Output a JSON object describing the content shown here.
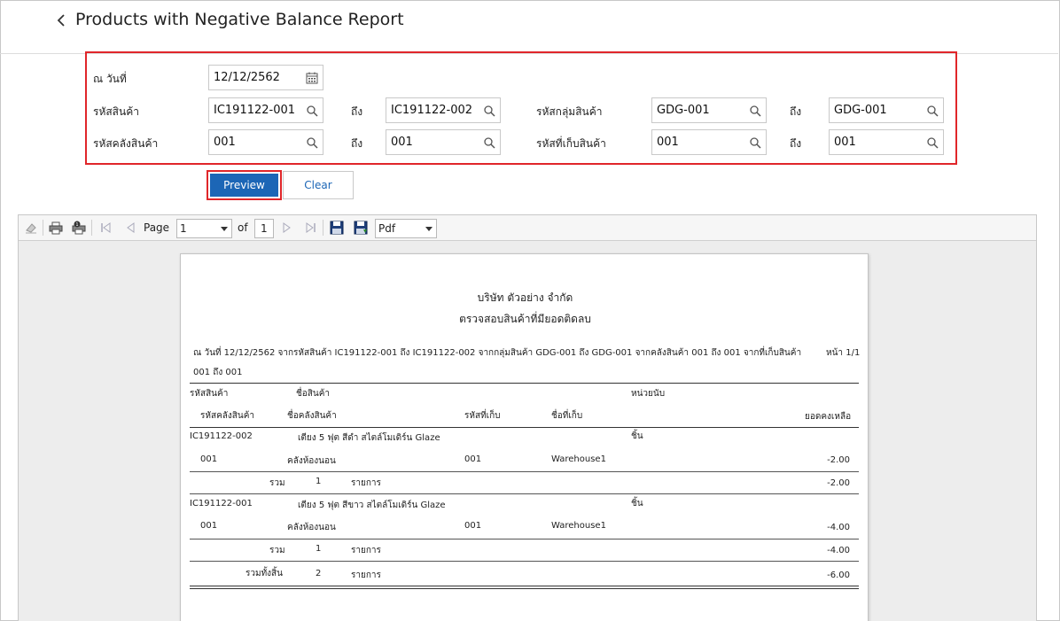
{
  "header": {
    "title": "Products with Negative Balance Report"
  },
  "filters": {
    "date_label": "ณ วันที่",
    "date_value": "12/12/2562",
    "product_code_label": "รหัสสินค้า",
    "product_from": "IC191122-001",
    "to_label": "ถึง",
    "product_to": "IC191122-002",
    "product_group_label": "รหัสกลุ่มสินค้า",
    "group_from": "GDG-001",
    "group_to": "GDG-001",
    "warehouse_label": "รหัสคลังสินค้า",
    "warehouse_from": "001",
    "warehouse_to": "001",
    "location_label": "รหัสที่เก็บสินค้า",
    "location_from": "001",
    "location_to": "001"
  },
  "buttons": {
    "preview": "Preview",
    "clear": "Clear"
  },
  "toolbar": {
    "page_label": "Page",
    "page_value": "1",
    "of_label": "of",
    "total_pages": "1",
    "format_value": "Pdf"
  },
  "report": {
    "company": "บริษัท ตัวอย่าง จำกัด",
    "title": "ตรวจสอบสินค้าที่มียอดติดลบ",
    "criteria_line1": "ณ วันที่ 12/12/2562 จากรหัสสินค้า IC191122-001 ถึง IC191122-002 จากกลุ่มสินค้า GDG-001 ถึง  GDG-001 จากคลังสินค้า 001 ถึง 001 จากที่เก็บสินค้า",
    "criteria_line2": "001 ถึง 001",
    "page_info": "หน้า 1/1",
    "col_product_code": "รหัสสินค้า",
    "col_product_name": "ชื่อสินค้า",
    "col_unit": "หน่วยนับ",
    "col_wh_code": "รหัสคลังสินค้า",
    "col_wh_name": "ชื่อคลังสินค้า",
    "col_loc_code": "รหัสที่เก็บ",
    "col_loc_name": "ชื่อที่เก็บ",
    "col_balance": "ยอดคงเหลือ",
    "items": [
      {
        "code": "IC191122-002",
        "name": "เตียง 5 ฟุต สีดำ สไตล์โมเดิร์น Glaze",
        "unit": "ชิ้น",
        "wh_code": "001",
        "wh_name": "คลังห้องนอน",
        "loc_code": "001",
        "loc_name": "Warehouse1",
        "balance": "-2.00",
        "sum_label": "รวม",
        "sum_count": "1",
        "sum_unit": "รายการ",
        "sum_balance": "-2.00"
      },
      {
        "code": "IC191122-001",
        "name": "เตียง 5 ฟุต สีขาว สไตล์โมเดิร์น Glaze",
        "unit": "ชิ้น",
        "wh_code": "001",
        "wh_name": "คลังห้องนอน",
        "loc_code": "001",
        "loc_name": "Warehouse1",
        "balance": "-4.00",
        "sum_label": "รวม",
        "sum_count": "1",
        "sum_unit": "รายการ",
        "sum_balance": "-4.00"
      }
    ],
    "grand_label": "รวมทั้งสิ้น",
    "grand_count": "2",
    "grand_unit": "รายการ",
    "grand_balance": "-6.00"
  },
  "colors": {
    "accent": "#1c66b6",
    "highlight": "#e0262a"
  }
}
